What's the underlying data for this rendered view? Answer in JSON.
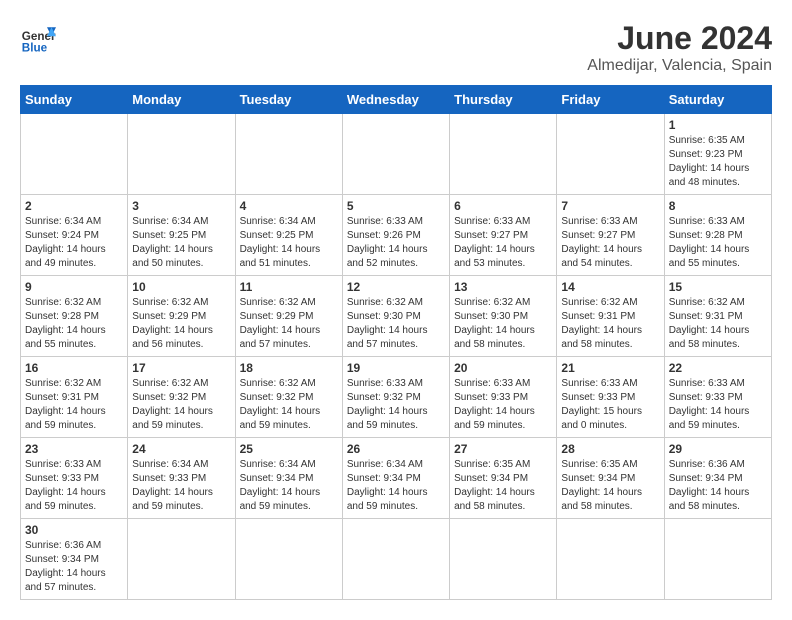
{
  "header": {
    "logo_text_regular": "General",
    "logo_text_blue": "Blue",
    "month_year": "June 2024",
    "location": "Almedijar, Valencia, Spain"
  },
  "weekdays": [
    "Sunday",
    "Monday",
    "Tuesday",
    "Wednesday",
    "Thursday",
    "Friday",
    "Saturday"
  ],
  "weeks": [
    [
      {
        "day": "",
        "info": ""
      },
      {
        "day": "",
        "info": ""
      },
      {
        "day": "",
        "info": ""
      },
      {
        "day": "",
        "info": ""
      },
      {
        "day": "",
        "info": ""
      },
      {
        "day": "",
        "info": ""
      },
      {
        "day": "1",
        "info": "Sunrise: 6:35 AM\nSunset: 9:23 PM\nDaylight: 14 hours and 48 minutes."
      }
    ],
    [
      {
        "day": "2",
        "info": "Sunrise: 6:34 AM\nSunset: 9:24 PM\nDaylight: 14 hours and 49 minutes."
      },
      {
        "day": "3",
        "info": "Sunrise: 6:34 AM\nSunset: 9:25 PM\nDaylight: 14 hours and 50 minutes."
      },
      {
        "day": "4",
        "info": "Sunrise: 6:34 AM\nSunset: 9:25 PM\nDaylight: 14 hours and 51 minutes."
      },
      {
        "day": "5",
        "info": "Sunrise: 6:33 AM\nSunset: 9:26 PM\nDaylight: 14 hours and 52 minutes."
      },
      {
        "day": "6",
        "info": "Sunrise: 6:33 AM\nSunset: 9:27 PM\nDaylight: 14 hours and 53 minutes."
      },
      {
        "day": "7",
        "info": "Sunrise: 6:33 AM\nSunset: 9:27 PM\nDaylight: 14 hours and 54 minutes."
      },
      {
        "day": "8",
        "info": "Sunrise: 6:33 AM\nSunset: 9:28 PM\nDaylight: 14 hours and 55 minutes."
      }
    ],
    [
      {
        "day": "9",
        "info": "Sunrise: 6:32 AM\nSunset: 9:28 PM\nDaylight: 14 hours and 55 minutes."
      },
      {
        "day": "10",
        "info": "Sunrise: 6:32 AM\nSunset: 9:29 PM\nDaylight: 14 hours and 56 minutes."
      },
      {
        "day": "11",
        "info": "Sunrise: 6:32 AM\nSunset: 9:29 PM\nDaylight: 14 hours and 57 minutes."
      },
      {
        "day": "12",
        "info": "Sunrise: 6:32 AM\nSunset: 9:30 PM\nDaylight: 14 hours and 57 minutes."
      },
      {
        "day": "13",
        "info": "Sunrise: 6:32 AM\nSunset: 9:30 PM\nDaylight: 14 hours and 58 minutes."
      },
      {
        "day": "14",
        "info": "Sunrise: 6:32 AM\nSunset: 9:31 PM\nDaylight: 14 hours and 58 minutes."
      },
      {
        "day": "15",
        "info": "Sunrise: 6:32 AM\nSunset: 9:31 PM\nDaylight: 14 hours and 58 minutes."
      }
    ],
    [
      {
        "day": "16",
        "info": "Sunrise: 6:32 AM\nSunset: 9:31 PM\nDaylight: 14 hours and 59 minutes."
      },
      {
        "day": "17",
        "info": "Sunrise: 6:32 AM\nSunset: 9:32 PM\nDaylight: 14 hours and 59 minutes."
      },
      {
        "day": "18",
        "info": "Sunrise: 6:32 AM\nSunset: 9:32 PM\nDaylight: 14 hours and 59 minutes."
      },
      {
        "day": "19",
        "info": "Sunrise: 6:33 AM\nSunset: 9:32 PM\nDaylight: 14 hours and 59 minutes."
      },
      {
        "day": "20",
        "info": "Sunrise: 6:33 AM\nSunset: 9:33 PM\nDaylight: 14 hours and 59 minutes."
      },
      {
        "day": "21",
        "info": "Sunrise: 6:33 AM\nSunset: 9:33 PM\nDaylight: 15 hours and 0 minutes."
      },
      {
        "day": "22",
        "info": "Sunrise: 6:33 AM\nSunset: 9:33 PM\nDaylight: 14 hours and 59 minutes."
      }
    ],
    [
      {
        "day": "23",
        "info": "Sunrise: 6:33 AM\nSunset: 9:33 PM\nDaylight: 14 hours and 59 minutes."
      },
      {
        "day": "24",
        "info": "Sunrise: 6:34 AM\nSunset: 9:33 PM\nDaylight: 14 hours and 59 minutes."
      },
      {
        "day": "25",
        "info": "Sunrise: 6:34 AM\nSunset: 9:34 PM\nDaylight: 14 hours and 59 minutes."
      },
      {
        "day": "26",
        "info": "Sunrise: 6:34 AM\nSunset: 9:34 PM\nDaylight: 14 hours and 59 minutes."
      },
      {
        "day": "27",
        "info": "Sunrise: 6:35 AM\nSunset: 9:34 PM\nDaylight: 14 hours and 58 minutes."
      },
      {
        "day": "28",
        "info": "Sunrise: 6:35 AM\nSunset: 9:34 PM\nDaylight: 14 hours and 58 minutes."
      },
      {
        "day": "29",
        "info": "Sunrise: 6:36 AM\nSunset: 9:34 PM\nDaylight: 14 hours and 58 minutes."
      }
    ],
    [
      {
        "day": "30",
        "info": "Sunrise: 6:36 AM\nSunset: 9:34 PM\nDaylight: 14 hours and 57 minutes."
      },
      {
        "day": "",
        "info": ""
      },
      {
        "day": "",
        "info": ""
      },
      {
        "day": "",
        "info": ""
      },
      {
        "day": "",
        "info": ""
      },
      {
        "day": "",
        "info": ""
      },
      {
        "day": "",
        "info": ""
      }
    ]
  ]
}
